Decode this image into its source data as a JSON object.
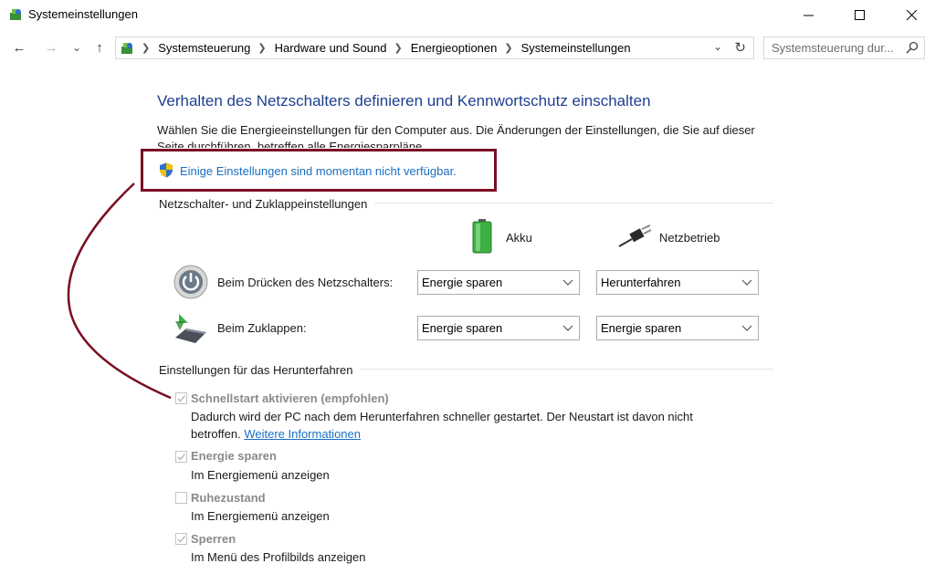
{
  "window": {
    "title": "Systemeinstellungen",
    "minimize": "—",
    "maximize": "☐",
    "close": "✕"
  },
  "nav": {
    "back": "←",
    "forward": "→",
    "recent": "⌄",
    "up": "↑",
    "breadcrumbs": [
      "Systemsteuerung",
      "Hardware und Sound",
      "Energieoptionen",
      "Systemeinstellungen"
    ],
    "refresh": "↻"
  },
  "search": {
    "placeholder": "Systemsteuerung dur..."
  },
  "content": {
    "title": "Verhalten des Netzschalters definieren und Kennwortschutz einschalten",
    "description": "Wählen Sie die Energieeinstellungen für den Computer aus. Die Änderungen der Einstellungen, die Sie auf dieser Seite durchführen, betreffen alle Energiesparpläne.",
    "unavailable_link": "Einige Einstellungen sind momentan nicht verfügbar.",
    "power_group_label": "Netzschalter- und Zuklappeinstellungen",
    "col_battery": "Akku",
    "col_plugged": "Netzbetrieb",
    "rows": [
      {
        "label": "Beim Drücken des Netzschalters:",
        "battery": "Energie sparen",
        "plugged": "Herunterfahren"
      },
      {
        "label": "Beim Zuklappen:",
        "battery": "Energie sparen",
        "plugged": "Energie sparen"
      }
    ],
    "shutdown_group_label": "Einstellungen für das Herunterfahren",
    "options": [
      {
        "label": "Schnellstart aktivieren (empfohlen)",
        "desc": "Dadurch wird der PC nach dem Herunterfahren schneller gestartet. Der Neustart ist davon nicht betroffen.",
        "link": "Weitere Informationen",
        "checked": true
      },
      {
        "label": "Energie sparen",
        "desc": "Im Energiemenü anzeigen",
        "checked": true
      },
      {
        "label": "Ruhezustand",
        "desc": "Im Energiemenü anzeigen",
        "checked": false
      },
      {
        "label": "Sperren",
        "desc": "Im Menü des Profilbilds anzeigen",
        "checked": true
      }
    ]
  },
  "colors": {
    "title_blue": "#1e3f8f",
    "link_blue": "#1a6fc4",
    "annotation": "#7a0d22",
    "disabled_text": "#8a8a8a"
  }
}
